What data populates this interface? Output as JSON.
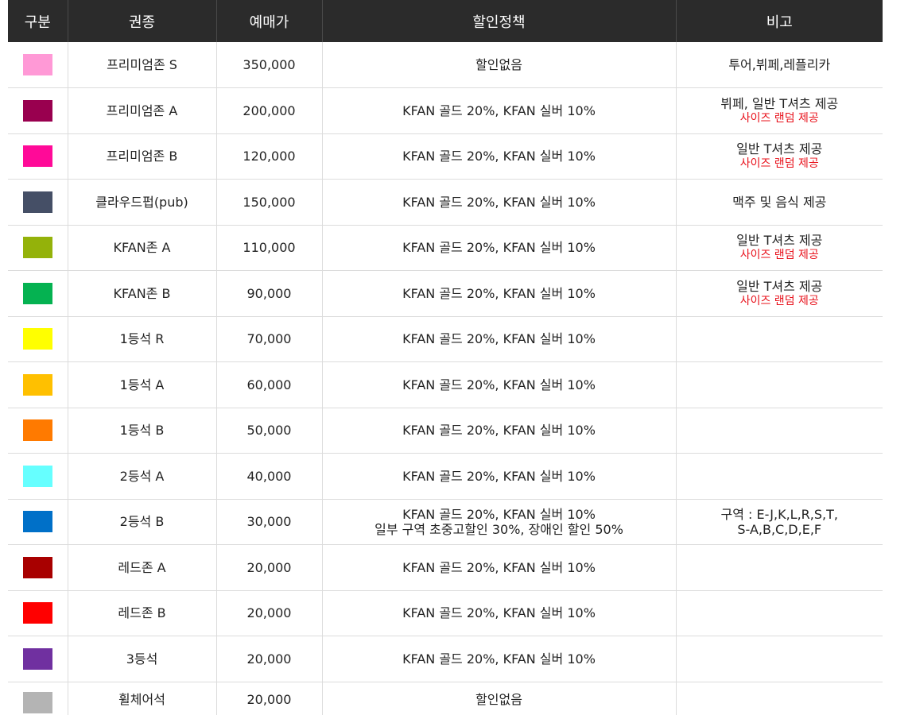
{
  "headers": [
    "구분",
    "권종",
    "예매가",
    "할인정책",
    "비고"
  ],
  "rows": [
    {
      "color": "#ff99d6",
      "name": "프리미엄존 S",
      "price": "350,000",
      "discount": [
        "할인없음"
      ],
      "note": "투어,뷔페,레플리카",
      "note_red": ""
    },
    {
      "color": "#99004f",
      "name": "프리미엄존 A",
      "price": "200,000",
      "discount": [
        "KFAN 골드 20%, KFAN 실버 10%"
      ],
      "note": "뷔페, 일반 T셔츠 제공",
      "note_red": "사이즈 랜덤 제공"
    },
    {
      "color": "#ff0a98",
      "name": "프리미엄존 B",
      "price": "120,000",
      "discount": [
        "KFAN 골드 20%, KFAN 실버 10%"
      ],
      "note": "일반 T셔츠 제공",
      "note_red": "사이즈 랜덤 제공"
    },
    {
      "color": "#454f66",
      "name": "클라우드펍(pub)",
      "price": "150,000",
      "discount": [
        "KFAN 골드 20%, KFAN 실버 10%"
      ],
      "note": "맥주 및 음식 제공",
      "note_red": ""
    },
    {
      "color": "#94b20a",
      "name": "KFAN존 A",
      "price": "110,000",
      "discount": [
        "KFAN 골드 20%, KFAN 실버 10%"
      ],
      "note": "일반 T셔츠 제공",
      "note_red": "사이즈 랜덤 제공"
    },
    {
      "color": "#05b251",
      "name": "KFAN존 B",
      "price": "90,000",
      "discount": [
        "KFAN 골드 20%, KFAN 실버 10%"
      ],
      "note": "일반 T셔츠 제공",
      "note_red": "사이즈 랜덤 제공"
    },
    {
      "color": "#ffff00",
      "name": "1등석 R",
      "price": "70,000",
      "discount": [
        "KFAN 골드 20%, KFAN 실버 10%"
      ],
      "note": "",
      "note_red": ""
    },
    {
      "color": "#ffc000",
      "name": "1등석 A",
      "price": "60,000",
      "discount": [
        "KFAN 골드 20%, KFAN 실버 10%"
      ],
      "note": "",
      "note_red": ""
    },
    {
      "color": "#ff7a00",
      "name": "1등석 B",
      "price": "50,000",
      "discount": [
        "KFAN 골드 20%, KFAN 실버 10%"
      ],
      "note": "",
      "note_red": ""
    },
    {
      "color": "#66ffff",
      "name": "2등석 A",
      "price": "40,000",
      "discount": [
        "KFAN 골드 20%, KFAN 실버 10%"
      ],
      "note": "",
      "note_red": ""
    },
    {
      "color": "#0070c8",
      "name": "2등석 B",
      "price": "30,000",
      "discount": [
        "KFAN 골드 20%, KFAN 실버 10%",
        "일부 구역 초중고할인 30%, 장애인 할인 50%"
      ],
      "note": "구역 : E-J,K,L,R,S,T,",
      "note2": "S-A,B,C,D,E,F",
      "note_red": ""
    },
    {
      "color": "#a80000",
      "name": "레드존 A",
      "price": "20,000",
      "discount": [
        "KFAN 골드 20%, KFAN 실버 10%"
      ],
      "note": "",
      "note_red": ""
    },
    {
      "color": "#ff0000",
      "name": "레드존 B",
      "price": "20,000",
      "discount": [
        "KFAN 골드 20%, KFAN 실버 10%"
      ],
      "note": "",
      "note_red": ""
    },
    {
      "color": "#7030a0",
      "name": "3등석",
      "price": "20,000",
      "discount": [
        "KFAN 골드 20%, KFAN 실버 10%"
      ],
      "note": "",
      "note_red": ""
    },
    {
      "color": "#b4b4b4",
      "name": "휠체어석",
      "price": "20,000",
      "discount": [
        "할인없음"
      ],
      "note": "",
      "note_red": ""
    }
  ]
}
